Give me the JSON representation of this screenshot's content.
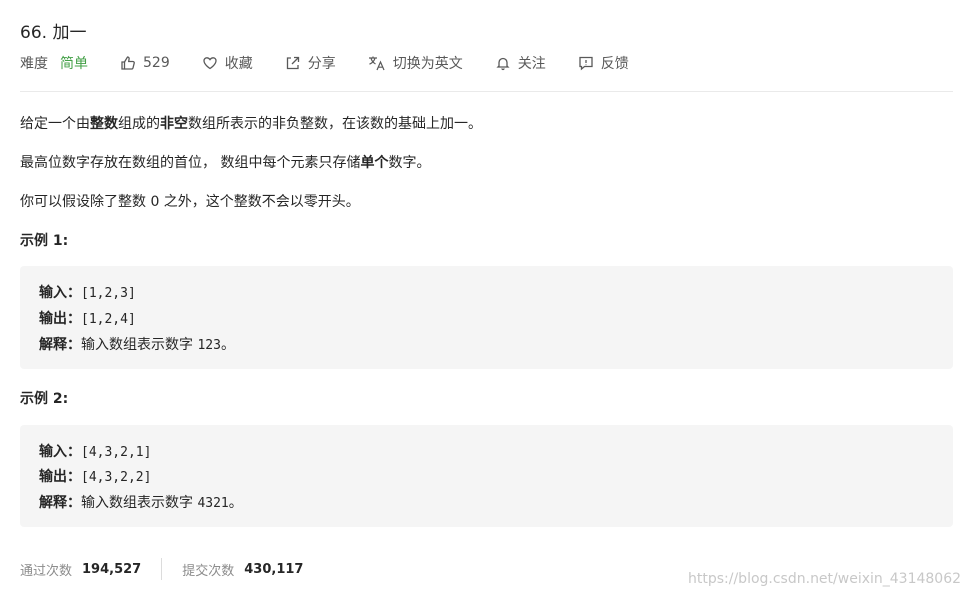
{
  "problem": {
    "title": "66. 加一",
    "difficulty_label": "难度",
    "difficulty_value": "简单",
    "difficulty_color": "#43a047",
    "likes": "529",
    "favorite_label": "收藏",
    "share_label": "分享",
    "translate_label": "切换为英文",
    "follow_label": "关注",
    "feedback_label": "反馈"
  },
  "description": {
    "p1": [
      {
        "t": "给定一个由",
        "b": false
      },
      {
        "t": "整数",
        "b": true
      },
      {
        "t": "组成的",
        "b": false
      },
      {
        "t": "非空",
        "b": true
      },
      {
        "t": "数组所表示的非负整数，在该数的基础上加一。",
        "b": false
      }
    ],
    "p2": [
      {
        "t": "最高位数字存放在数组的首位， 数组中每个元素只存储",
        "b": false
      },
      {
        "t": "单个",
        "b": true
      },
      {
        "t": "数字。",
        "b": false
      }
    ],
    "p3": "你可以假设除了整数 0 之外，这个整数不会以零开头。"
  },
  "examples": [
    {
      "title": "示例 1:",
      "input_label": "输入：",
      "input_value": "[1,2,3]",
      "output_label": "输出：",
      "output_value": "[1,2,4]",
      "explain_label": "解释：",
      "explain_text": "输入数组表示数字 ",
      "explain_num": "123",
      "explain_end": "。"
    },
    {
      "title": "示例 2:",
      "input_label": "输入：",
      "input_value": "[4,3,2,1]",
      "output_label": "输出：",
      "output_value": "[4,3,2,2]",
      "explain_label": "解释：",
      "explain_text": "输入数组表示数字 ",
      "explain_num": "4321",
      "explain_end": "。"
    }
  ],
  "stats": {
    "accepted_label": "通过次数",
    "accepted_value": "194,527",
    "submissions_label": "提交次数",
    "submissions_value": "430,117"
  },
  "watermark": "https://blog.csdn.net/weixin_43148062"
}
